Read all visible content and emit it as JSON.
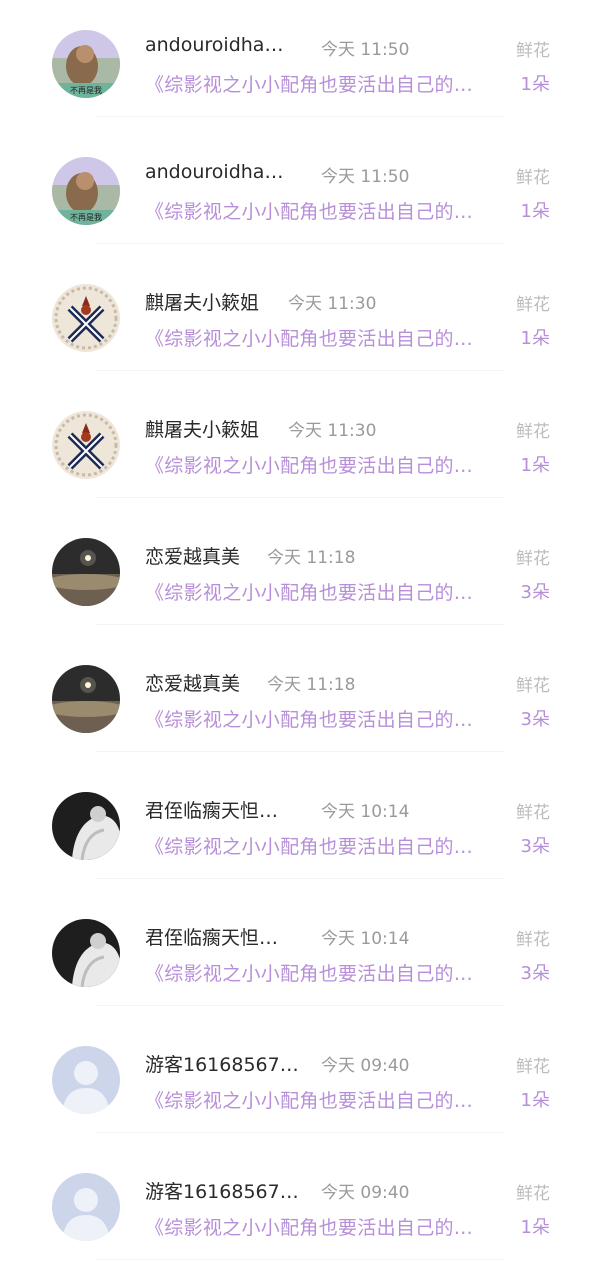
{
  "items": [
    {
      "name": "andouroidha…",
      "time": "今天 11:50",
      "gift_label": "鲜花",
      "book": "《综影视之小小配角也要活出自己的…",
      "count": "1朵",
      "avatar": "photo-avatar-girl",
      "avatar_text": "不再是我"
    },
    {
      "name": "andouroidha…",
      "time": "今天 11:50",
      "gift_label": "鲜花",
      "book": "《综影视之小小配角也要活出自己的…",
      "count": "1朵",
      "avatar": "photo-avatar-girl",
      "avatar_text": "不再是我"
    },
    {
      "name": "麒屠夫小簌姐",
      "time": "今天 11:30",
      "gift_label": "鲜花",
      "book": "《综影视之小小配角也要活出自己的…",
      "count": "1朵",
      "avatar": "emblem-avatar"
    },
    {
      "name": "麒屠夫小簌姐",
      "time": "今天 11:30",
      "gift_label": "鲜花",
      "book": "《综影视之小小配角也要活出自己的…",
      "count": "1朵",
      "avatar": "emblem-avatar"
    },
    {
      "name": "恋爱越真美",
      "time": "今天 11:18",
      "gift_label": "鲜花",
      "book": "《综影视之小小配角也要活出自己的…",
      "count": "3朵",
      "avatar": "moon-landscape-avatar"
    },
    {
      "name": "恋爱越真美",
      "time": "今天 11:18",
      "gift_label": "鲜花",
      "book": "《综影视之小小配角也要活出自己的…",
      "count": "3朵",
      "avatar": "moon-landscape-avatar"
    },
    {
      "name": "君侄临瘸天怛…",
      "time": "今天 10:14",
      "gift_label": "鲜花",
      "book": "《综影视之小小配角也要活出自己的…",
      "count": "3朵",
      "avatar": "bw-figure-avatar"
    },
    {
      "name": "君侄临瘸天怛…",
      "time": "今天 10:14",
      "gift_label": "鲜花",
      "book": "《综影视之小小配角也要活出自己的…",
      "count": "3朵",
      "avatar": "bw-figure-avatar"
    },
    {
      "name": "游客16168567…",
      "time": "今天 09:40",
      "gift_label": "鲜花",
      "book": "《综影视之小小配角也要活出自己的…",
      "count": "1朵",
      "avatar": "default-user-avatar"
    },
    {
      "name": "游客16168567…",
      "time": "今天 09:40",
      "gift_label": "鲜花",
      "book": "《综影视之小小配角也要活出自己的…",
      "count": "1朵",
      "avatar": "default-user-avatar"
    }
  ]
}
